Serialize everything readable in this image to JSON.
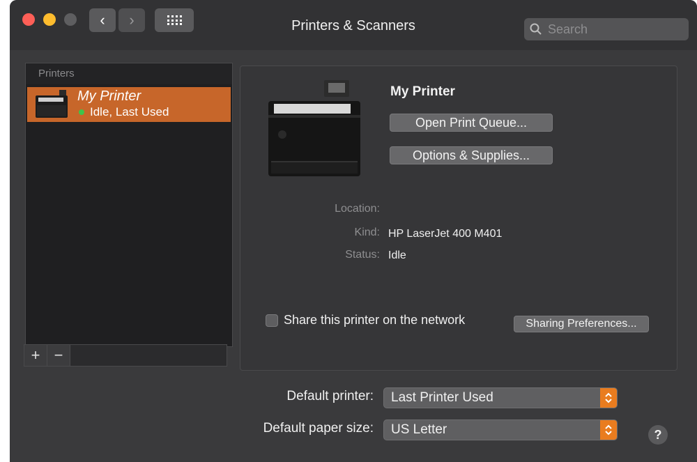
{
  "window": {
    "title": "Printers & Scanners",
    "search": {
      "placeholder": "Search",
      "value": ""
    },
    "icons": [
      "close-button",
      "minimize-button",
      "zoom-button",
      "chevron-left-icon",
      "chevron-right-icon",
      "grid-icon",
      "search-icon"
    ]
  },
  "printers_list": {
    "header": "Printers",
    "items": [
      {
        "name": "My Printer",
        "status": "Idle, Last Used",
        "status_color": "#3ec44a",
        "selected": true
      }
    ],
    "add_label": "+",
    "remove_label": "−"
  },
  "details": {
    "name": "My Printer",
    "open_queue_label": "Open Print Queue...",
    "options_label": "Options & Supplies...",
    "location_label": "Location:",
    "location_value": "",
    "kind_label": "Kind:",
    "kind_value": "HP LaserJet 400 M401",
    "status_label": "Status:",
    "status_value": "Idle",
    "share_label": "Share this printer on the network",
    "share_checked": false,
    "sharing_prefs_label": "Sharing Preferences..."
  },
  "defaults": {
    "printer_label": "Default printer:",
    "printer_value": "Last Printer Used",
    "paper_label": "Default paper size:",
    "paper_value": "US Letter"
  },
  "help_label": "?",
  "colors": {
    "selection": "#c7662a",
    "popup_accent": "#e97c1f",
    "window_bg": "#3a3a3c"
  }
}
